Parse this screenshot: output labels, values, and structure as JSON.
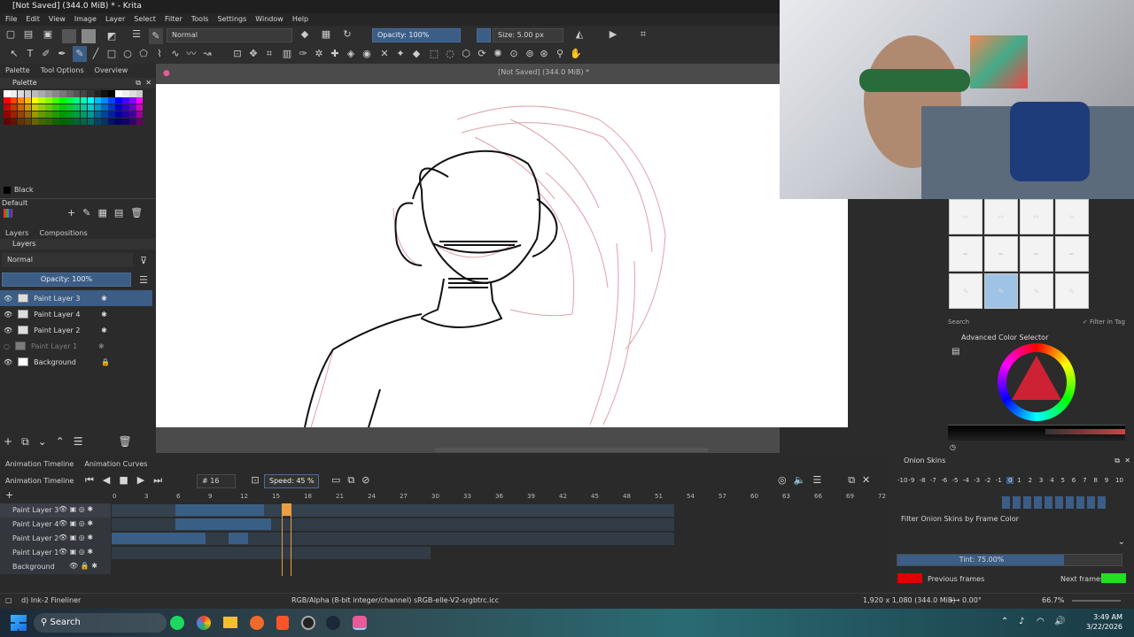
{
  "window": {
    "title": "[Not Saved]  (344.0 MiB) * - Krita"
  },
  "menu": [
    "File",
    "Edit",
    "View",
    "Image",
    "Layer",
    "Select",
    "Filter",
    "Tools",
    "Settings",
    "Window",
    "Help"
  ],
  "toolbar": {
    "blend_mode": "Normal",
    "opacity": "Opacity: 100%",
    "size": "Size: 5.00 px"
  },
  "left_tabs": [
    "Palette",
    "Tool Options",
    "Overview"
  ],
  "palette": {
    "title": "Palette",
    "current_color_name": "Black",
    "palette_name": "Default"
  },
  "layers_panel": {
    "tabs": [
      "Layers",
      "Compositions"
    ],
    "blend_mode": "Normal",
    "opacity": "Opacity:  100%",
    "layers": [
      {
        "name": "Paint Layer 3",
        "selected": true
      },
      {
        "name": "Paint Layer 4",
        "selected": false
      },
      {
        "name": "Paint Layer 2",
        "selected": false
      },
      {
        "name": "Paint Layer 1",
        "selected": false
      },
      {
        "name": "Background",
        "selected": false
      }
    ]
  },
  "canvas": {
    "header": "[Not Saved]  (344.0 MiB) *"
  },
  "brush_presets": {
    "search_placeholder": "Search",
    "filter_in_tag": "Filter in Tag"
  },
  "color_selector": {
    "title": "Advanced Color Selector"
  },
  "animation": {
    "tabs": [
      "Animation Timeline",
      "Animation Curves"
    ],
    "panel_title": "Animation Timeline",
    "frame": "16",
    "speed": "Speed: 45 %",
    "ruler": [
      "0",
      "3",
      "6",
      "9",
      "12",
      "15",
      "18",
      "21",
      "24",
      "27",
      "30",
      "33",
      "36",
      "39",
      "42",
      "45",
      "48",
      "51",
      "54",
      "57",
      "60",
      "63",
      "66",
      "69",
      "72"
    ],
    "tracks": [
      "Paint Layer 3",
      "Paint Layer 4",
      "Paint Layer 2",
      "Paint Layer 1",
      "Background"
    ]
  },
  "onion_skins": {
    "title": "Onion Skins",
    "scale": [
      "-10",
      "-9",
      "-8",
      "-7",
      "-6",
      "-5",
      "-4",
      "-3",
      "-2",
      "-1",
      "0",
      "1",
      "2",
      "3",
      "4",
      "5",
      "6",
      "7",
      "8",
      "9",
      "10"
    ],
    "filter_label": "Filter Onion Skins by Frame Color",
    "tint": "Tint: 75.00%",
    "tint_fraction": 0.75,
    "previous_label": "Previous frames",
    "next_label": "Next frames",
    "previous_color": "#e00000",
    "next_color": "#20e020"
  },
  "status": {
    "brush": "d) Ink-2 Fineliner",
    "color_space": "RGB/Alpha (8-bit integer/channel)  sRGB-elle-V2-srgbtrc.icc",
    "dimensions": "1,920 x 1,080 (344.0 MiB)",
    "rotation": "0.00°",
    "zoom": "66.7%"
  },
  "taskbar": {
    "search": "Search",
    "time": "3:49 AM",
    "date": "3/22/2026"
  }
}
